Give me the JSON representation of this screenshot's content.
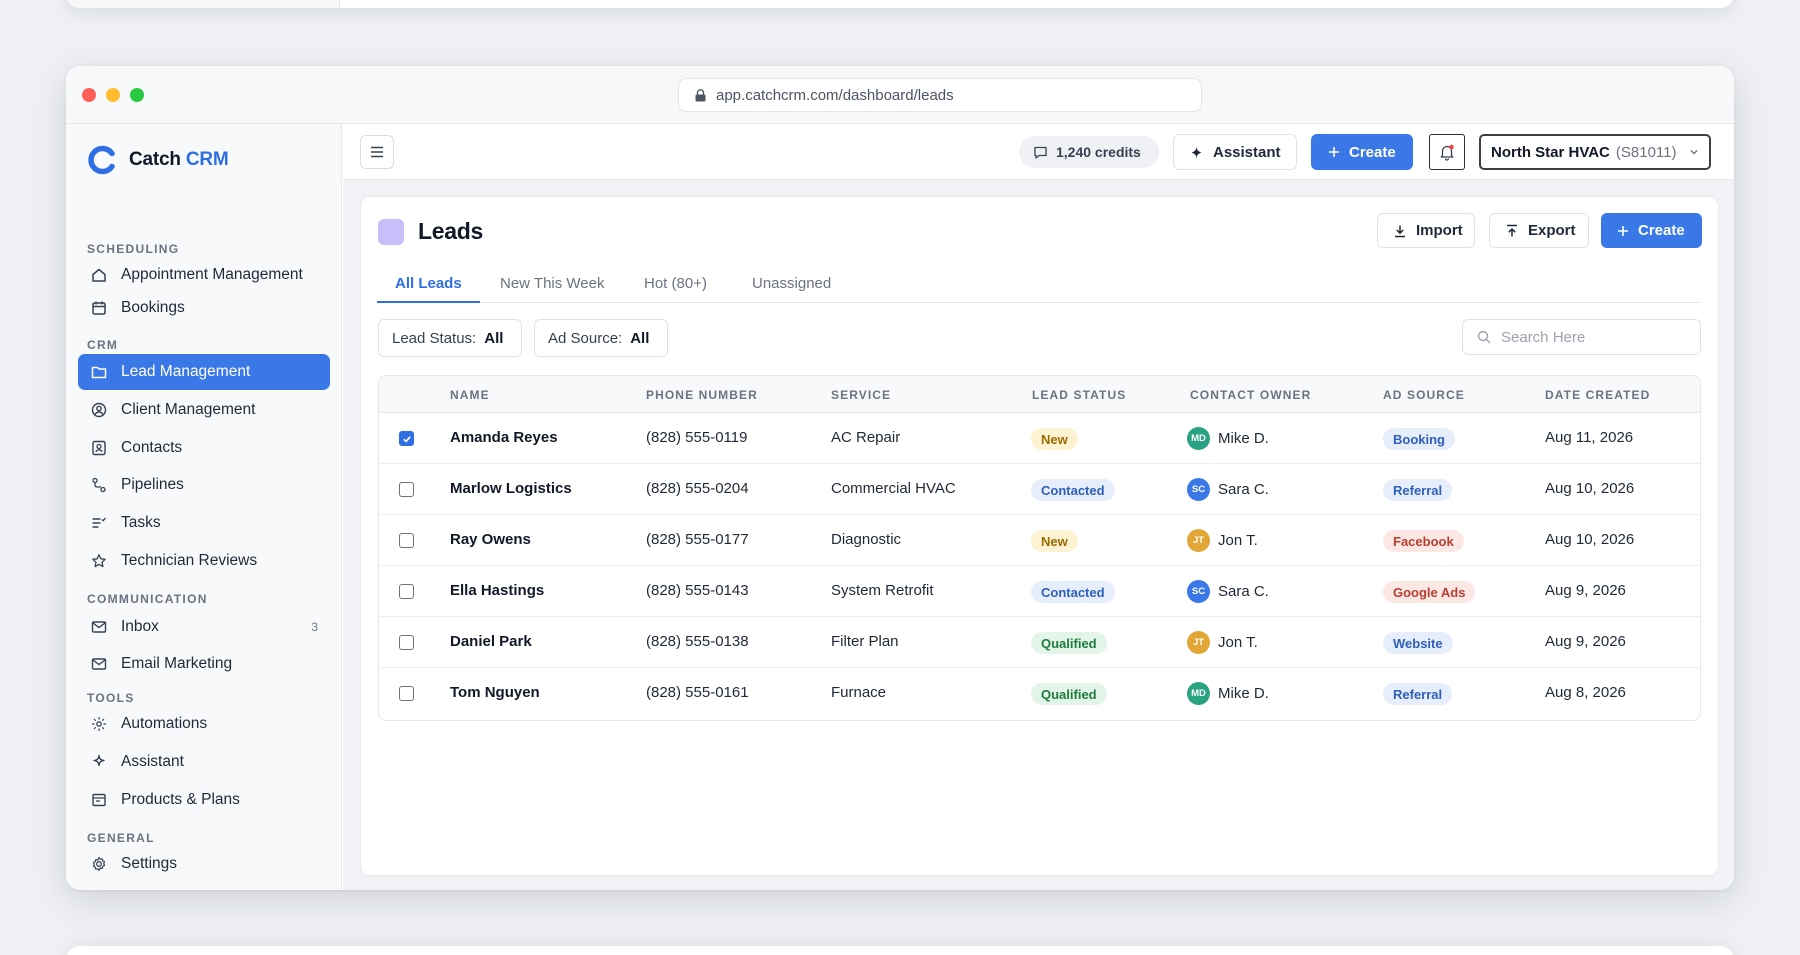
{
  "browser": {
    "url": "app.catchcrm.com/dashboard/leads"
  },
  "brand": {
    "name": "Catch",
    "accent": "CRM",
    "color": "#2f6fe4"
  },
  "sidebar": {
    "sections": [
      {
        "title": "SCHEDULING"
      },
      {
        "title": "CRM"
      },
      {
        "title": "COMMUNICATION"
      },
      {
        "title": "TOOLS"
      },
      {
        "title": "GENERAL"
      }
    ],
    "items": [
      {
        "label": "Appointment Management",
        "icon": "home-icon"
      },
      {
        "label": "Bookings",
        "icon": "calendar-icon"
      },
      {
        "label": "Lead Management",
        "icon": "folder-icon",
        "active": true
      },
      {
        "label": "Client Management",
        "icon": "user-circle-icon"
      },
      {
        "label": "Contacts",
        "icon": "contact-card-icon"
      },
      {
        "label": "Pipelines",
        "icon": "pipeline-icon"
      },
      {
        "label": "Tasks",
        "icon": "tasks-icon"
      },
      {
        "label": "Technician Reviews",
        "icon": "star-icon"
      },
      {
        "label": "Inbox",
        "icon": "mail-icon",
        "count": "3"
      },
      {
        "label": "Email Marketing",
        "icon": "mail-icon"
      },
      {
        "label": "Automations",
        "icon": "automation-icon"
      },
      {
        "label": "Assistant",
        "icon": "sparkle-icon"
      },
      {
        "label": "Products & Plans",
        "icon": "products-icon"
      },
      {
        "label": "Settings",
        "icon": "gear-icon"
      }
    ]
  },
  "topbar": {
    "credits": "1,240 credits",
    "assistant_label": "Assistant",
    "create_label": "Create",
    "account_name": "North Star HVAC",
    "account_id": "(S81011)"
  },
  "page": {
    "title": "Leads",
    "import_label": "Import",
    "export_label": "Export",
    "create_label": "Create",
    "tabs": [
      "All Leads",
      "New This Week",
      "Hot (80+)",
      "Unassigned"
    ],
    "active_tab": "All Leads",
    "filters": [
      {
        "label": "Lead Status:",
        "value": "All"
      },
      {
        "label": "Ad Source:",
        "value": "All"
      }
    ],
    "search_placeholder": "Search Here"
  },
  "table": {
    "columns": [
      "NAME",
      "PHONE NUMBER",
      "SERVICE",
      "LEAD STATUS",
      "CONTACT OWNER",
      "AD SOURCE",
      "DATE CREATED"
    ],
    "rows": [
      {
        "checked": true,
        "name": "Amanda Reyes",
        "phone": "(828) 555-0119",
        "service": "AC Repair",
        "status": "New",
        "owner_initials": "MD",
        "owner": "Mike D.",
        "source": "Booking",
        "date": "Aug 11, 2026"
      },
      {
        "checked": false,
        "name": "Marlow Logistics",
        "phone": "(828) 555-0204",
        "service": "Commercial HVAC",
        "status": "Contacted",
        "owner_initials": "SC",
        "owner": "Sara C.",
        "source": "Referral",
        "date": "Aug 10, 2026"
      },
      {
        "checked": false,
        "name": "Ray Owens",
        "phone": "(828) 555-0177",
        "service": "Diagnostic",
        "status": "New",
        "owner_initials": "JT",
        "owner": "Jon T.",
        "source": "Facebook",
        "date": "Aug 10, 2026"
      },
      {
        "checked": false,
        "name": "Ella Hastings",
        "phone": "(828) 555-0143",
        "service": "System Retrofit",
        "status": "Contacted",
        "owner_initials": "SC",
        "owner": "Sara C.",
        "source": "Google Ads",
        "date": "Aug 9, 2026"
      },
      {
        "checked": false,
        "name": "Daniel Park",
        "phone": "(828) 555-0138",
        "service": "Filter Plan",
        "status": "Qualified",
        "owner_initials": "JT",
        "owner": "Jon T.",
        "source": "Website",
        "date": "Aug 9, 2026"
      },
      {
        "checked": false,
        "name": "Tom Nguyen",
        "phone": "(828) 555-0161",
        "service": "Furnace",
        "status": "Qualified",
        "owner_initials": "MD",
        "owner": "Mike D.",
        "source": "Referral",
        "date": "Aug 8, 2026"
      }
    ]
  },
  "colors": {
    "primary": "#3b78e7",
    "status": {
      "New": {
        "bg": "#fdf3d3",
        "fg": "#9a6b00"
      },
      "Contacted": {
        "bg": "#e6eefc",
        "fg": "#2f5fb8"
      },
      "Qualified": {
        "bg": "#e2f5e8",
        "fg": "#1f7a3f"
      }
    },
    "source": {
      "Booking": {
        "bg": "#e6eefc",
        "fg": "#2f5fb8"
      },
      "Referral": {
        "bg": "#e6eefc",
        "fg": "#2f5fb8"
      },
      "Website": {
        "bg": "#e6eefc",
        "fg": "#2f5fb8"
      },
      "Facebook": {
        "bg": "#fde7e4",
        "fg": "#b6402f"
      },
      "Google Ads": {
        "bg": "#fde7e4",
        "fg": "#b6402f"
      }
    },
    "avatars": {
      "MD": "#2aa383",
      "SC": "#3b78e7",
      "JT": "#e2a636"
    }
  }
}
